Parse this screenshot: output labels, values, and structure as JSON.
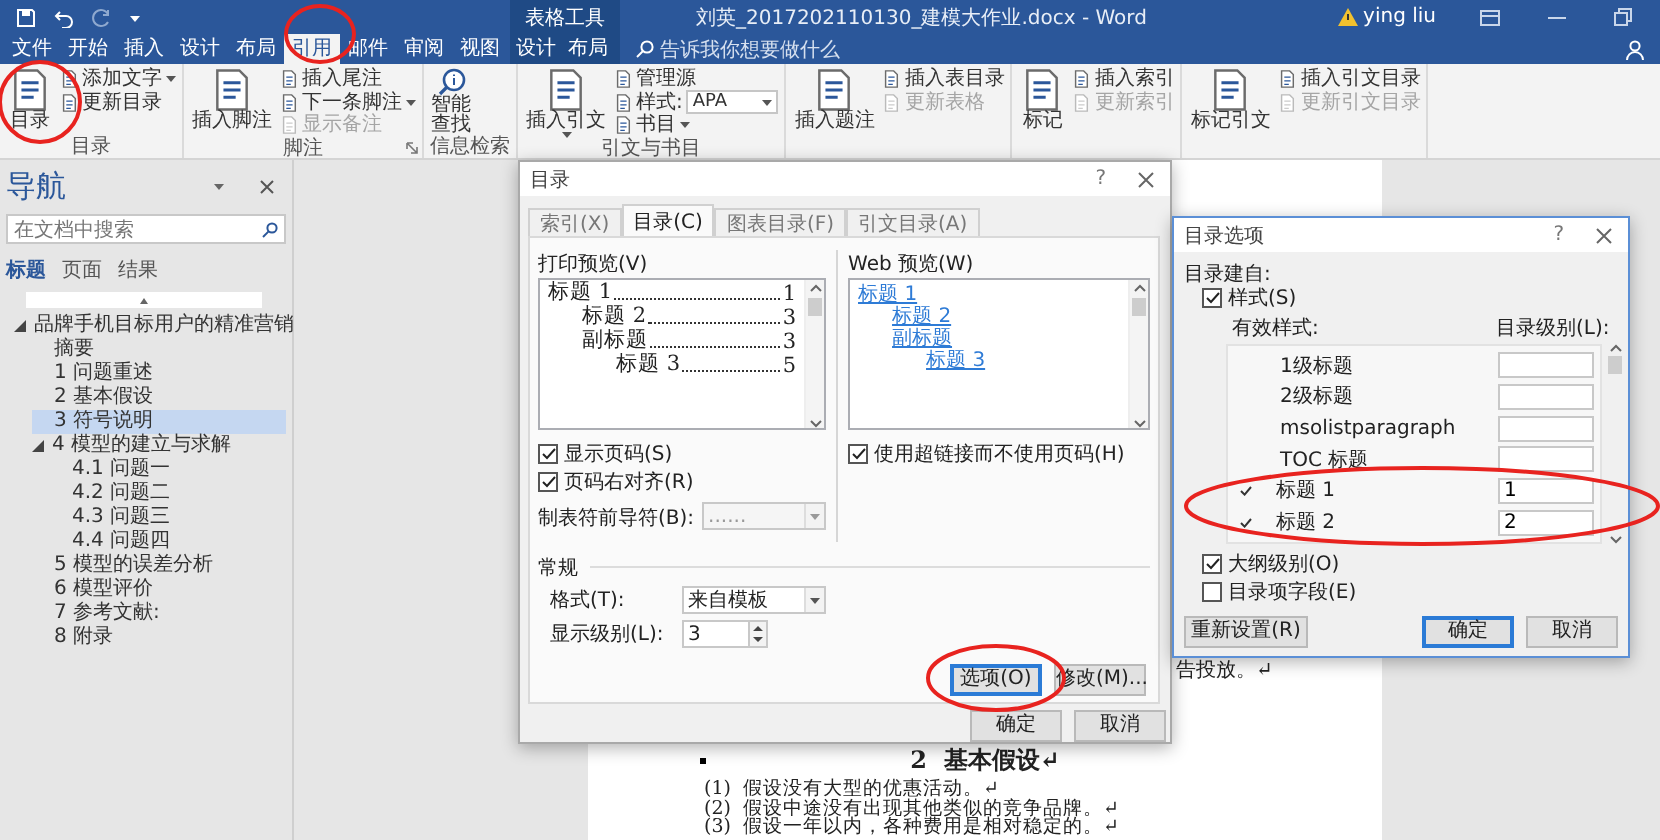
{
  "title_bar": {
    "context_group": "表格工具",
    "title": "刘英_2017202110130_建模大作业.docx - Word",
    "user": "ying liu"
  },
  "ribbon_tabs": [
    {
      "label": "文件",
      "selected": false,
      "context": false
    },
    {
      "label": "开始",
      "selected": false,
      "context": false
    },
    {
      "label": "插入",
      "selected": false,
      "context": false
    },
    {
      "label": "设计",
      "selected": false,
      "context": false
    },
    {
      "label": "布局",
      "selected": false,
      "context": false
    },
    {
      "label": "引用",
      "selected": true,
      "context": false
    },
    {
      "label": "邮件",
      "selected": false,
      "context": false
    },
    {
      "label": "审阅",
      "selected": false,
      "context": false
    },
    {
      "label": "视图",
      "selected": false,
      "context": false
    },
    {
      "label": "设计",
      "selected": false,
      "context": true
    },
    {
      "label": "布局",
      "selected": false,
      "context": true
    }
  ],
  "tell_me": {
    "placeholder": "告诉我你想要做什么"
  },
  "ribbon_groups": [
    {
      "label": "目录",
      "buttons": [
        {
          "kind": "large",
          "label": "目录",
          "disabled": false
        },
        {
          "kind": "small",
          "label": "添加文字",
          "dropdown": true,
          "disabled": false
        },
        {
          "kind": "small",
          "label": "更新目录",
          "disabled": false
        }
      ]
    },
    {
      "label": "脚注",
      "launcher": true,
      "buttons": [
        {
          "kind": "large",
          "label": "插入脚注",
          "disabled": false
        },
        {
          "kind": "small",
          "label": "插入尾注",
          "disabled": false
        },
        {
          "kind": "small",
          "label": "下一条脚注",
          "dropdown": true,
          "disabled": false
        },
        {
          "kind": "small",
          "label": "显示备注",
          "disabled": true
        }
      ]
    },
    {
      "label": "信息检索",
      "buttons": [
        {
          "kind": "tall",
          "label": "智能查找",
          "disabled": false
        }
      ]
    },
    {
      "label": "引文与书目",
      "buttons": [
        {
          "kind": "large",
          "label": "插入引文",
          "dropdown": true,
          "disabled": false
        },
        {
          "kind": "small",
          "label": "管理源",
          "disabled": false
        },
        {
          "kind": "combo",
          "label": "样式:",
          "value": "APA",
          "dropdown": true,
          "disabled": false
        },
        {
          "kind": "small",
          "label": "书目",
          "dropdown": true,
          "disabled": false
        }
      ]
    },
    {
      "buttons": [
        {
          "kind": "large",
          "label": "插入题注",
          "disabled": false
        },
        {
          "kind": "small",
          "label": "插入表目录",
          "disabled": false
        },
        {
          "kind": "small",
          "label": "更新表格",
          "disabled": true
        }
      ]
    },
    {
      "buttons": [
        {
          "kind": "large",
          "label": "标记",
          "disabled": false
        },
        {
          "kind": "small",
          "label": "插入索引",
          "disabled": false
        },
        {
          "kind": "small",
          "label": "更新索引",
          "disabled": true
        }
      ]
    },
    {
      "buttons": [
        {
          "kind": "large",
          "label": "标记引文",
          "disabled": false
        },
        {
          "kind": "small",
          "label": "插入引文目录",
          "disabled": false
        },
        {
          "kind": "small",
          "label": "更新引文目录",
          "disabled": true
        }
      ]
    }
  ],
  "navigation": {
    "title": "导航",
    "search": {
      "placeholder": "在文档中搜索"
    },
    "tabs": [
      {
        "label": "标题",
        "selected": true
      },
      {
        "label": "页面",
        "selected": false
      },
      {
        "label": "结果",
        "selected": false
      }
    ],
    "headings": [
      {
        "label": "品牌手机目标用户的精准营销",
        "selected": false,
        "expanded": true,
        "children": [
          {
            "label": "摘要",
            "selected": false
          },
          {
            "label": "1 问题重述",
            "selected": false
          },
          {
            "label": "2 基本假设",
            "selected": false
          },
          {
            "label": "3 符号说明",
            "selected": true
          },
          {
            "label": "4 模型的建立与求解",
            "selected": false,
            "expanded": true,
            "children": [
              {
                "label": "4.1 问题一",
                "selected": false
              },
              {
                "label": "4.2 问题二",
                "selected": false
              },
              {
                "label": "4.3 问题三",
                "selected": false
              },
              {
                "label": "4.4 问题四",
                "selected": false
              }
            ]
          },
          {
            "label": "5 模型的误差分析",
            "selected": false
          },
          {
            "label": "6 模型评价",
            "selected": false
          },
          {
            "label": "7 参考文献:",
            "selected": false
          },
          {
            "label": "8 附录",
            "selected": false
          }
        ]
      }
    ]
  },
  "document": {
    "paragraphs": [
      {
        "kind": "text",
        "text": "告投放。↵"
      },
      {
        "kind": "heading",
        "text": "2  基本假设↵"
      },
      {
        "kind": "list_item",
        "number": "(1)",
        "text": "假设没有大型的优惠活动。↵"
      },
      {
        "kind": "list_item",
        "number": "(2)",
        "text": "假设中途没有出现其他类似的竞争品牌。↵"
      },
      {
        "kind": "list_item",
        "number": "(3)",
        "text": "假设一年以内，各种费用是相对稳定的。↵"
      }
    ]
  },
  "toc_dialog": {
    "title": "目录",
    "help": "?",
    "tabs": [
      {
        "label": "索引(X)",
        "selected": false
      },
      {
        "label": "目录(C)",
        "selected": true
      },
      {
        "label": "图表目录(F)",
        "selected": false
      },
      {
        "label": "引文目录(A)",
        "selected": false
      }
    ],
    "print_preview": {
      "label": "打印预览(V)",
      "entries": [
        {
          "text": "标题 1",
          "page": "1",
          "children": [
            {
              "text": "标题 2",
              "page": "3"
            },
            {
              "text": "副标题",
              "page": "3",
              "children": [
                {
                  "text": "标题 3",
                  "page": "5"
                }
              ]
            }
          ]
        }
      ]
    },
    "web_preview": {
      "label": "Web 预览(W)",
      "entries": [
        {
          "text": "标题 1",
          "children": [
            {
              "text": "标题 2"
            },
            {
              "text": "副标题",
              "children": [
                {
                  "text": "标题 3"
                }
              ]
            }
          ]
        }
      ]
    },
    "left_checkboxes": [
      {
        "label": "显示页码(S)",
        "checked": true
      },
      {
        "label": "页码右对齐(R)",
        "checked": true
      }
    ],
    "tab_leader": {
      "label": "制表符前导符(B):",
      "value": "......"
    },
    "hyperlink_option": {
      "label": "使用超链接而不使用页码(H)",
      "checked": true
    },
    "general": {
      "label": "常规",
      "format": {
        "label": "格式(T):",
        "value": "来自模板"
      },
      "show_levels": {
        "label": "显示级别(L):",
        "value": "3"
      }
    },
    "buttons": [
      {
        "label": "选项(O)",
        "focused": true
      },
      {
        "label": "修改(M)...",
        "focused": false
      }
    ],
    "footer_buttons": [
      {
        "label": "确定",
        "focused": false
      },
      {
        "label": "取消",
        "focused": false
      }
    ]
  },
  "options_dialog": {
    "title": "目录选项",
    "help": "?",
    "build_from": "目录建自:",
    "styles_option": {
      "label": "样式(S)",
      "checked": true
    },
    "columns": [
      "有效样式:",
      "目录级别(L):"
    ],
    "styles": [
      {
        "name": "1级标题",
        "in_use": false
      },
      {
        "name": "2级标题",
        "in_use": false
      },
      {
        "name": "msolistparagraph",
        "in_use": false
      },
      {
        "name": "TOC 标题",
        "in_use": false
      },
      {
        "name": "标题 1",
        "in_use": true,
        "toc_level": "1"
      },
      {
        "name": "标题 2",
        "in_use": true,
        "toc_level": "2"
      }
    ],
    "more_options": [
      {
        "label": "大纲级别(O)",
        "checked": true
      },
      {
        "label": "目录项字段(E)",
        "checked": false
      }
    ],
    "buttons": [
      {
        "label": "重新设置(R)",
        "focused": false
      },
      {
        "label": "确定",
        "focused": true
      },
      {
        "label": "取消",
        "focused": false
      }
    ]
  }
}
